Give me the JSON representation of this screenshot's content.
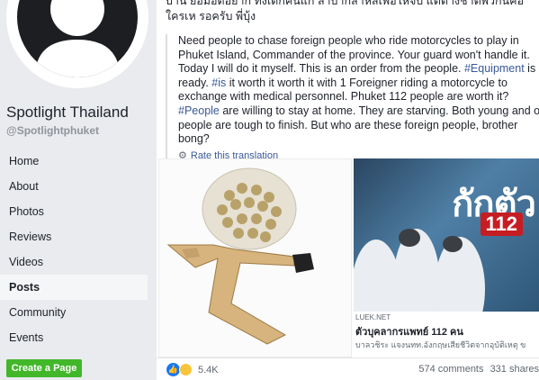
{
  "sidebar": {
    "page_name": "Spotlight Thailand",
    "page_handle": "@Spotlightphuket",
    "nav": [
      {
        "label": "Home"
      },
      {
        "label": "About"
      },
      {
        "label": "Photos"
      },
      {
        "label": "Reviews"
      },
      {
        "label": "Videos"
      },
      {
        "label": "Posts",
        "active": true
      },
      {
        "label": "Community"
      },
      {
        "label": "Events"
      }
    ],
    "create_page": "Create a Page"
  },
  "post": {
    "thai_text": "บ้าน ยอมอดอยาก ทั้งเด็กคนแก่ ลำบากสาหัสเพื่อให้จบ แต่ต่างชาติพวกนี้คือใครเห รอครับ พี่บุ้ง",
    "translation": {
      "part1": "Need people to chase foreign people who ride motorcycles to play in Phuket Island, Commander of the province. Your guard won't handle it. Today I will do it myself. This is an order from the people. ",
      "tag1": "#Equipment",
      "part2": " is ready. ",
      "tag2": "#is",
      "part3": " it worth it worth it with 1 Foreigner riding a motorcycle to exchange with medical personnel. Phuket 112 people are worth it? ",
      "tag3": "#People",
      "part4": " are willing to stay at home. They are starving. Both young and old people are tough to finish. But who are these foreign people, brother bong?"
    },
    "rate_translation": "Rate this translation",
    "link": {
      "overlay_text": "กักตัว",
      "overlay_number": "112",
      "source": "LUEK.NET",
      "title": "ตัวบุคลากรแพทย์ 112 คน",
      "description": "บาลวชิระ แจงนทท.อังกฤษเสียชีวิตจากอุบัติเหตุ ข"
    },
    "reaction_count": "5.4K",
    "comments": "574 comments",
    "shares": "331 shares"
  }
}
